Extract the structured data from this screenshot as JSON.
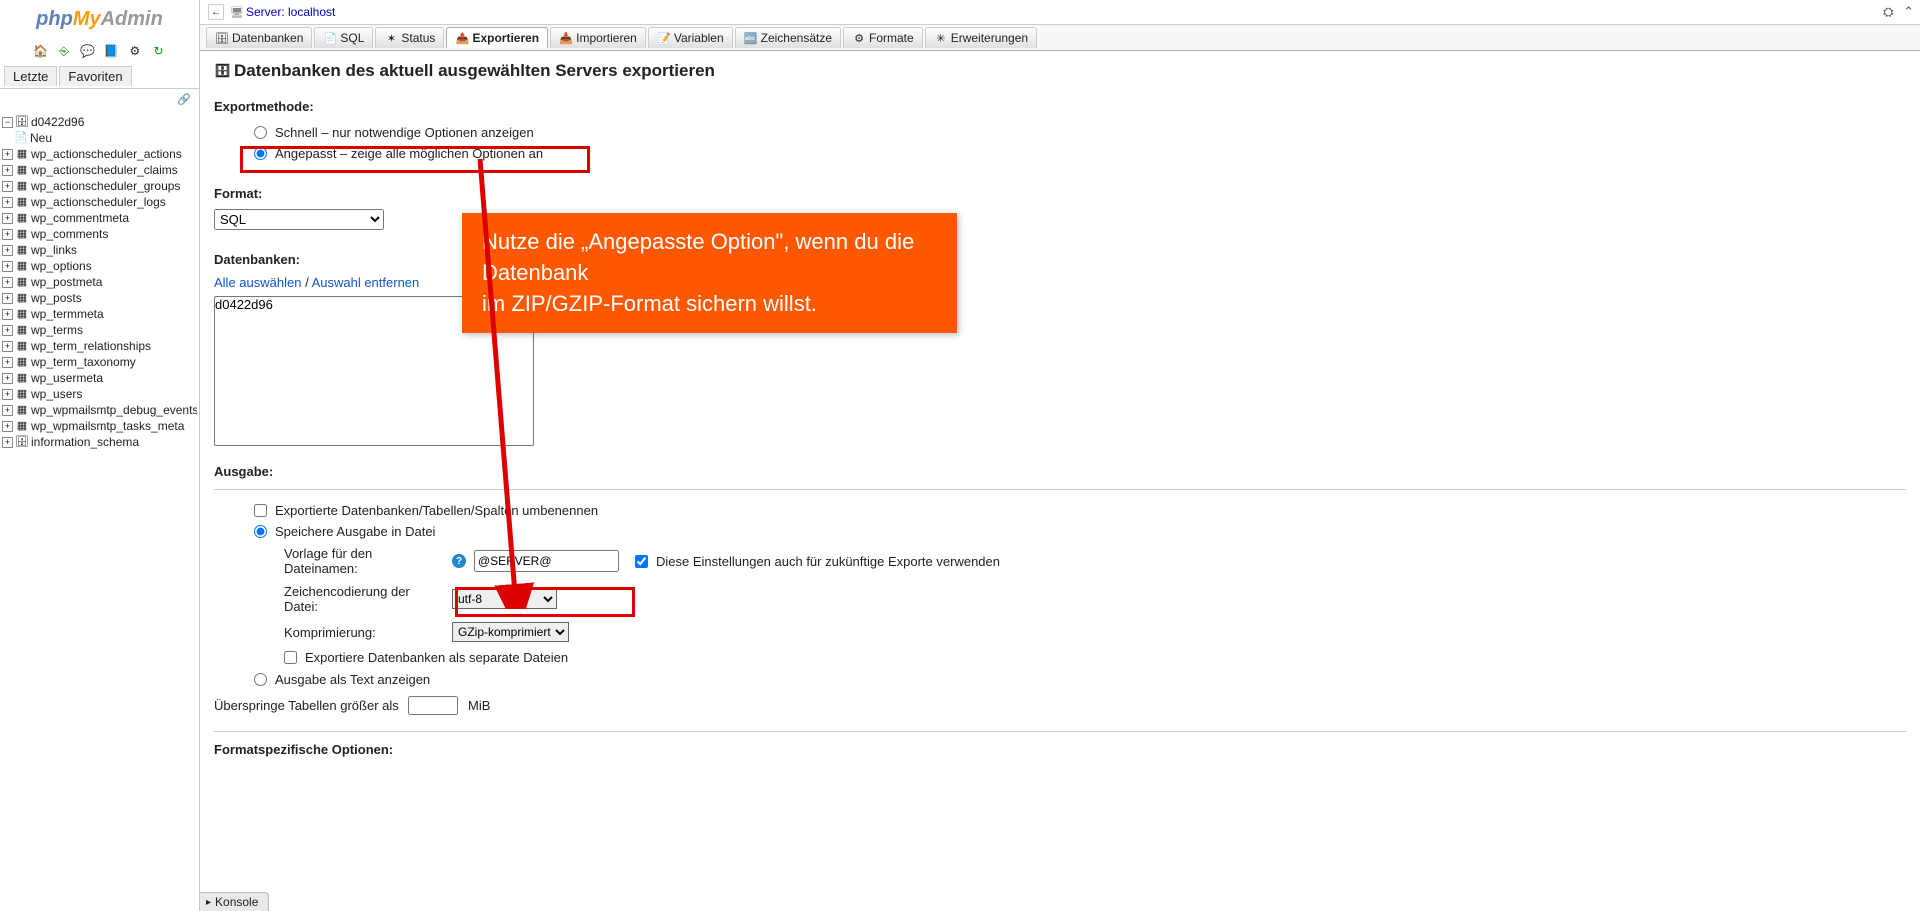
{
  "logo": {
    "php": "php",
    "my": "My",
    "admin": "Admin"
  },
  "sidebar_tabs": {
    "recent": "Letzte",
    "fav": "Favoriten"
  },
  "tree": {
    "root": "d0422d96",
    "new_label": "Neu",
    "tables": [
      "wp_actionscheduler_actions",
      "wp_actionscheduler_claims",
      "wp_actionscheduler_groups",
      "wp_actionscheduler_logs",
      "wp_commentmeta",
      "wp_comments",
      "wp_links",
      "wp_options",
      "wp_postmeta",
      "wp_posts",
      "wp_termmeta",
      "wp_terms",
      "wp_term_relationships",
      "wp_term_taxonomy",
      "wp_usermeta",
      "wp_users",
      "wp_wpmailsmtp_debug_events",
      "wp_wpmailsmtp_tasks_meta"
    ],
    "other_db": "information_schema"
  },
  "server": {
    "label_prefix": "Server:",
    "name": "localhost"
  },
  "tabs": [
    {
      "label": "Datenbanken",
      "icon": "🗄"
    },
    {
      "label": "SQL",
      "icon": "📄"
    },
    {
      "label": "Status",
      "icon": "✶"
    },
    {
      "label": "Exportieren",
      "icon": "📤",
      "active": true
    },
    {
      "label": "Importieren",
      "icon": "📥"
    },
    {
      "label": "Variablen",
      "icon": "📝"
    },
    {
      "label": "Zeichensätze",
      "icon": "🔤"
    },
    {
      "label": "Formate",
      "icon": "⚙"
    },
    {
      "label": "Erweiterungen",
      "icon": "✳"
    }
  ],
  "page": {
    "title": "Datenbanken des aktuell ausgewählten Servers exportieren",
    "export_method_label": "Exportmethode:",
    "method_quick": "Schnell – nur notwendige Optionen anzeigen",
    "method_custom": "Angepasst – zeige alle möglichen Optionen an",
    "format_label": "Format:",
    "format_value": "SQL",
    "db_label": "Datenbanken:",
    "select_all": "Alle auswählen",
    "deselect_all": "Auswahl entfernen",
    "db_option": "d0422d96",
    "output_label": "Ausgabe:",
    "rename_label": "Exportierte Datenbanken/Tabellen/Spalten umbenennen",
    "save_file_label": "Speichere Ausgabe in Datei",
    "template_label": "Vorlage für den Dateinamen:",
    "template_value": "@SERVER@",
    "future_label": "Diese Einstellungen auch für zukünftige Exporte verwenden",
    "encoding_label": "Zeichencodierung der Datei:",
    "encoding_value": "utf-8",
    "compression_label": "Komprimierung:",
    "compression_value": "GZip-komprimiert",
    "separate_files_label": "Exportiere Datenbanken als separate Dateien",
    "output_text_label": "Ausgabe als Text anzeigen",
    "skip_label_pre": "Überspringe Tabellen größer als",
    "skip_label_post": "MiB",
    "format_specific_label": "Formatspezifische Optionen:",
    "console_label": "Konsole",
    "callout_line1": "Nutze die „Angepasste Option\", wenn du die Datenbank",
    "callout_line2": "im ZIP/GZIP-Format sichern willst."
  }
}
